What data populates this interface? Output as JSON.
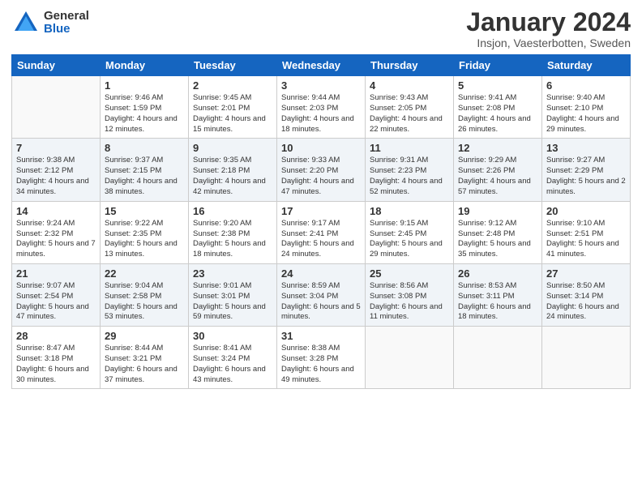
{
  "header": {
    "logo_general": "General",
    "logo_blue": "Blue",
    "month_title": "January 2024",
    "location": "Insjon, Vaesterbotten, Sweden"
  },
  "days_of_week": [
    "Sunday",
    "Monday",
    "Tuesday",
    "Wednesday",
    "Thursday",
    "Friday",
    "Saturday"
  ],
  "weeks": [
    [
      {
        "day": "",
        "info": ""
      },
      {
        "day": "1",
        "info": "Sunrise: 9:46 AM\nSunset: 1:59 PM\nDaylight: 4 hours\nand 12 minutes."
      },
      {
        "day": "2",
        "info": "Sunrise: 9:45 AM\nSunset: 2:01 PM\nDaylight: 4 hours\nand 15 minutes."
      },
      {
        "day": "3",
        "info": "Sunrise: 9:44 AM\nSunset: 2:03 PM\nDaylight: 4 hours\nand 18 minutes."
      },
      {
        "day": "4",
        "info": "Sunrise: 9:43 AM\nSunset: 2:05 PM\nDaylight: 4 hours\nand 22 minutes."
      },
      {
        "day": "5",
        "info": "Sunrise: 9:41 AM\nSunset: 2:08 PM\nDaylight: 4 hours\nand 26 minutes."
      },
      {
        "day": "6",
        "info": "Sunrise: 9:40 AM\nSunset: 2:10 PM\nDaylight: 4 hours\nand 29 minutes."
      }
    ],
    [
      {
        "day": "7",
        "info": "Sunrise: 9:38 AM\nSunset: 2:12 PM\nDaylight: 4 hours\nand 34 minutes."
      },
      {
        "day": "8",
        "info": "Sunrise: 9:37 AM\nSunset: 2:15 PM\nDaylight: 4 hours\nand 38 minutes."
      },
      {
        "day": "9",
        "info": "Sunrise: 9:35 AM\nSunset: 2:18 PM\nDaylight: 4 hours\nand 42 minutes."
      },
      {
        "day": "10",
        "info": "Sunrise: 9:33 AM\nSunset: 2:20 PM\nDaylight: 4 hours\nand 47 minutes."
      },
      {
        "day": "11",
        "info": "Sunrise: 9:31 AM\nSunset: 2:23 PM\nDaylight: 4 hours\nand 52 minutes."
      },
      {
        "day": "12",
        "info": "Sunrise: 9:29 AM\nSunset: 2:26 PM\nDaylight: 4 hours\nand 57 minutes."
      },
      {
        "day": "13",
        "info": "Sunrise: 9:27 AM\nSunset: 2:29 PM\nDaylight: 5 hours\nand 2 minutes."
      }
    ],
    [
      {
        "day": "14",
        "info": "Sunrise: 9:24 AM\nSunset: 2:32 PM\nDaylight: 5 hours\nand 7 minutes."
      },
      {
        "day": "15",
        "info": "Sunrise: 9:22 AM\nSunset: 2:35 PM\nDaylight: 5 hours\nand 13 minutes."
      },
      {
        "day": "16",
        "info": "Sunrise: 9:20 AM\nSunset: 2:38 PM\nDaylight: 5 hours\nand 18 minutes."
      },
      {
        "day": "17",
        "info": "Sunrise: 9:17 AM\nSunset: 2:41 PM\nDaylight: 5 hours\nand 24 minutes."
      },
      {
        "day": "18",
        "info": "Sunrise: 9:15 AM\nSunset: 2:45 PM\nDaylight: 5 hours\nand 29 minutes."
      },
      {
        "day": "19",
        "info": "Sunrise: 9:12 AM\nSunset: 2:48 PM\nDaylight: 5 hours\nand 35 minutes."
      },
      {
        "day": "20",
        "info": "Sunrise: 9:10 AM\nSunset: 2:51 PM\nDaylight: 5 hours\nand 41 minutes."
      }
    ],
    [
      {
        "day": "21",
        "info": "Sunrise: 9:07 AM\nSunset: 2:54 PM\nDaylight: 5 hours\nand 47 minutes."
      },
      {
        "day": "22",
        "info": "Sunrise: 9:04 AM\nSunset: 2:58 PM\nDaylight: 5 hours\nand 53 minutes."
      },
      {
        "day": "23",
        "info": "Sunrise: 9:01 AM\nSunset: 3:01 PM\nDaylight: 5 hours\nand 59 minutes."
      },
      {
        "day": "24",
        "info": "Sunrise: 8:59 AM\nSunset: 3:04 PM\nDaylight: 6 hours\nand 5 minutes."
      },
      {
        "day": "25",
        "info": "Sunrise: 8:56 AM\nSunset: 3:08 PM\nDaylight: 6 hours\nand 11 minutes."
      },
      {
        "day": "26",
        "info": "Sunrise: 8:53 AM\nSunset: 3:11 PM\nDaylight: 6 hours\nand 18 minutes."
      },
      {
        "day": "27",
        "info": "Sunrise: 8:50 AM\nSunset: 3:14 PM\nDaylight: 6 hours\nand 24 minutes."
      }
    ],
    [
      {
        "day": "28",
        "info": "Sunrise: 8:47 AM\nSunset: 3:18 PM\nDaylight: 6 hours\nand 30 minutes."
      },
      {
        "day": "29",
        "info": "Sunrise: 8:44 AM\nSunset: 3:21 PM\nDaylight: 6 hours\nand 37 minutes."
      },
      {
        "day": "30",
        "info": "Sunrise: 8:41 AM\nSunset: 3:24 PM\nDaylight: 6 hours\nand 43 minutes."
      },
      {
        "day": "31",
        "info": "Sunrise: 8:38 AM\nSunset: 3:28 PM\nDaylight: 6 hours\nand 49 minutes."
      },
      {
        "day": "",
        "info": ""
      },
      {
        "day": "",
        "info": ""
      },
      {
        "day": "",
        "info": ""
      }
    ]
  ]
}
